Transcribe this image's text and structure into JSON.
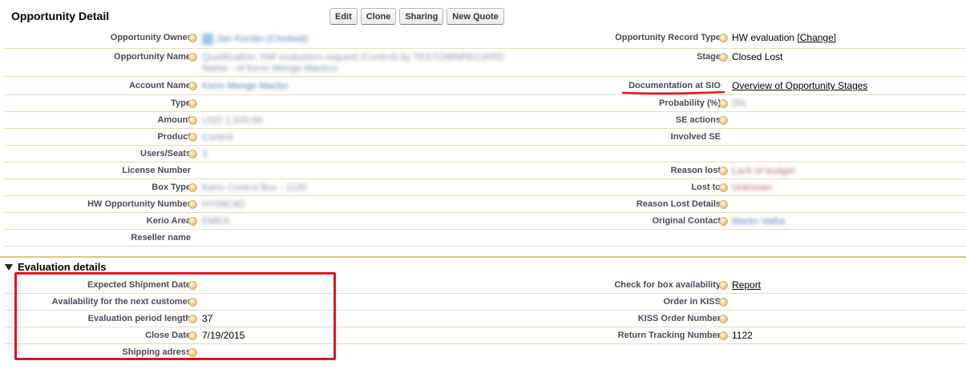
{
  "header": {
    "title": "Opportunity Detail",
    "buttons": [
      "Edit",
      "Clone",
      "Sharing",
      "New Quote"
    ]
  },
  "detail": {
    "left": [
      {
        "label": "Opportunity Owner",
        "value": "Jan Kocián (Chetwal)"
      },
      {
        "label": "Opportunity Name",
        "value": "Qualification: HW evaluation request (Control) by TESTOWNRECIARD Name - of Kerio Menge Macbox"
      },
      {
        "label": "Account Name",
        "value": "Kerio Menge Macbo"
      },
      {
        "label": "Type",
        "value": ""
      },
      {
        "label": "Amount",
        "value": "USD 1,500.00"
      },
      {
        "label": "Product",
        "value": "Control"
      },
      {
        "label": "Users/Seats",
        "value": "3"
      },
      {
        "label": "License Number",
        "value": ""
      },
      {
        "label": "Box Type",
        "value": "Kerio Control Box - 1120"
      },
      {
        "label": "HW Opportunity Number",
        "value": "HY09C4D"
      },
      {
        "label": "Kerio Area",
        "value": "EMEA"
      },
      {
        "label": "Reseller name",
        "value": ""
      }
    ],
    "right": [
      {
        "label": "Opportunity Record Type",
        "value": "HW evaluation",
        "link": "[Change]"
      },
      {
        "label": "Stage",
        "value": "Closed Lost"
      },
      {
        "label": "Documentation at SIO",
        "value": "Overview of Opportunity Stages"
      },
      {
        "label": "Probability (%)",
        "value": "0%"
      },
      {
        "label": "SE actions",
        "value": ""
      },
      {
        "label": "Involved SE",
        "value": ""
      },
      {
        "label": "Reason lost",
        "value": "Lack of budget"
      },
      {
        "label": "Lost to",
        "value": "Unknown"
      },
      {
        "label": "Reason Lost Details",
        "value": ""
      },
      {
        "label": "Original Contact",
        "value": "Martin Valha"
      }
    ]
  },
  "evaluation": {
    "title": "Evaluation details",
    "left": [
      {
        "label": "Expected Shipment Date",
        "value": ""
      },
      {
        "label": "Availability for the next customer",
        "value": ""
      },
      {
        "label": "Evaluation period length",
        "value": "37"
      },
      {
        "label": "Close Date",
        "value": "7/19/2015"
      },
      {
        "label": "Shipping adress",
        "value": ""
      }
    ],
    "right": [
      {
        "label": "Check for box availability",
        "value": "Report"
      },
      {
        "label": "Order in KISS",
        "value": ""
      },
      {
        "label": "KISS Order Number",
        "value": ""
      },
      {
        "label": "Return Tracking Number",
        "value": "1122"
      }
    ]
  },
  "colors": {
    "annotation_red": "#e4101f",
    "row_divider": "#e3deb8",
    "section_divider": "#d9c58c",
    "label_text": "#4a4a56"
  }
}
